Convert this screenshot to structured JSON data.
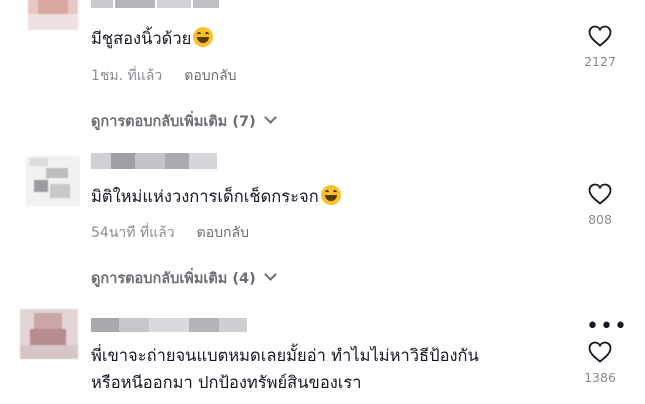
{
  "comments": [
    {
      "text": "มีชูสองนิ้วด้วย",
      "emoji": "grinning-sweat-emoji",
      "time": "1ชม. ที่แล้ว",
      "reply_label": "ตอบกลับ",
      "likes": "2127",
      "view_replies": "ดูการตอบกลับเพิ่มเติม (7)"
    },
    {
      "text": "มิติใหม่แห่งวงการเด็กเช็ดกระจก",
      "emoji": "grinning-sweat-emoji",
      "time": "54นาที ที่แล้ว",
      "reply_label": "ตอบกลับ",
      "likes": "808",
      "view_replies": "ดูการตอบกลับเพิ่มเติม (4)"
    },
    {
      "text_line1": "พี่เขาจะถ่ายจนแบตหมดเลยมั้ยอ่า ทำไมไม่หาวิธีป้องกัน",
      "text_line2": "หรือหนีออกมา ปกป้องทรัพย์สินของเรา",
      "likes": "1386"
    }
  ],
  "colors": {
    "text": "#161823",
    "secondary": "#8a8b91",
    "emoji": "#f7c22b"
  },
  "icons": [
    "heart-outline-icon",
    "chevron-down-icon",
    "more-options-icon",
    "grinning-sweat-emoji"
  ]
}
